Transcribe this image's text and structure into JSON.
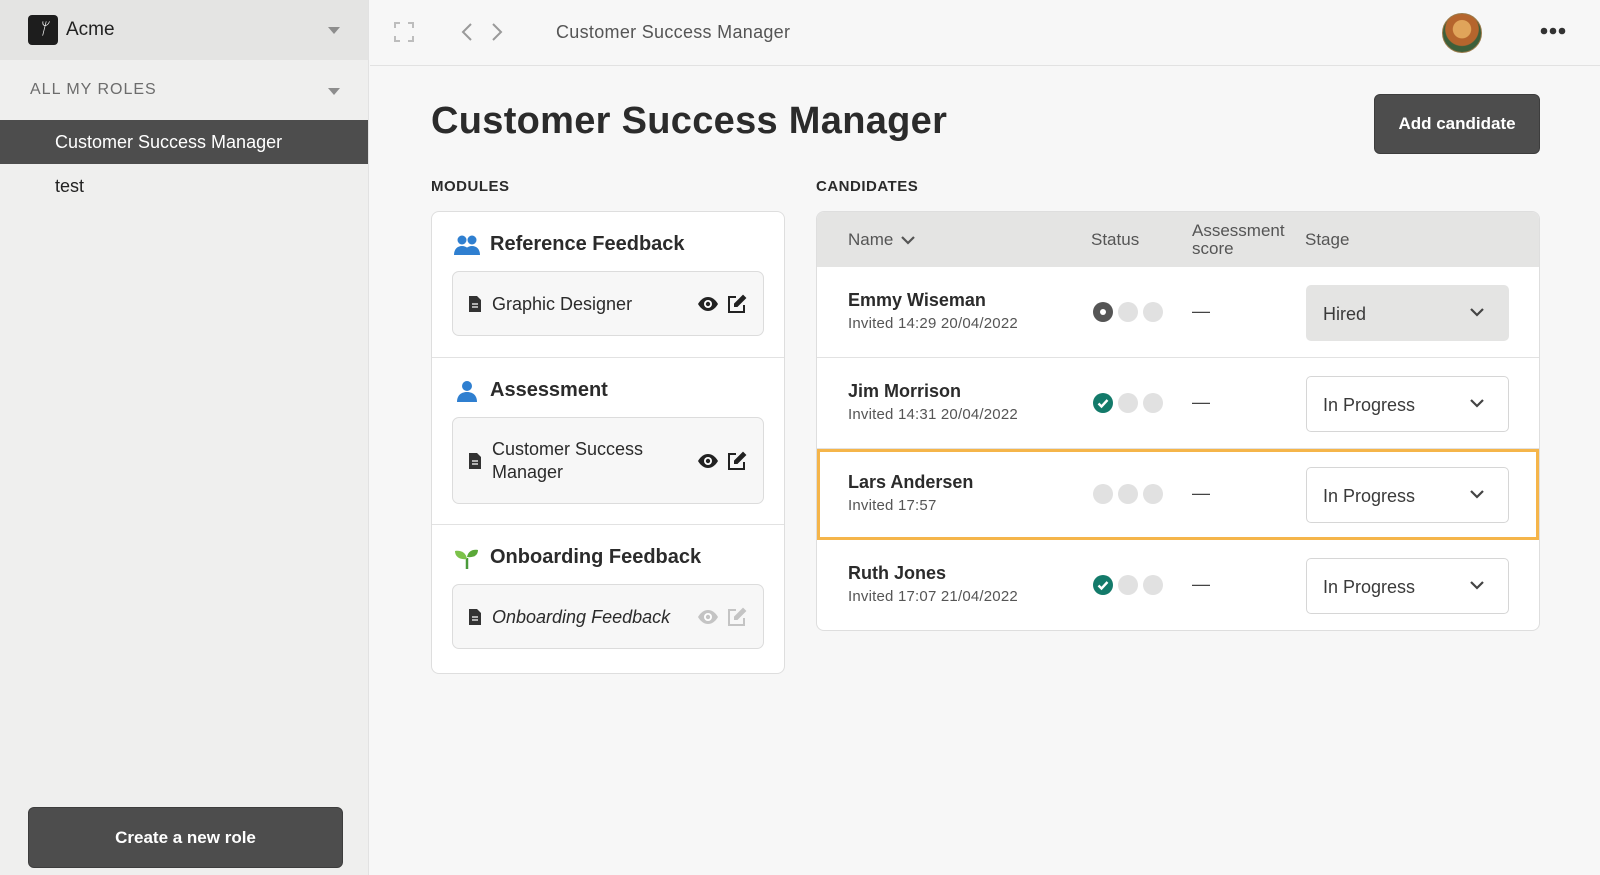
{
  "org": {
    "name": "Acme"
  },
  "sidebar": {
    "roles_title": "ALL MY ROLES",
    "roles": [
      {
        "label": "Customer Success Manager",
        "active": true
      },
      {
        "label": "test",
        "active": false
      }
    ],
    "create_label": "Create a new role"
  },
  "topbar": {
    "breadcrumb": "Customer Success Manager"
  },
  "main": {
    "title": "Customer Success Manager",
    "add_candidate_label": "Add candidate",
    "modules_label": "MODULES",
    "candidates_label": "CANDIDATES"
  },
  "modules": [
    {
      "title": "Reference Feedback",
      "icon": "people-icon",
      "card": "Graphic Designer",
      "italic": false
    },
    {
      "title": "Assessment",
      "icon": "person-icon",
      "card": "Customer Success Manager",
      "italic": false
    },
    {
      "title": "Onboarding Feedback",
      "icon": "seedling-icon",
      "card": "Onboarding Feedback",
      "italic": true
    }
  ],
  "candidates_table": {
    "headers": {
      "name": "Name",
      "status": "Status",
      "score": "Assessment score",
      "stage": "Stage"
    },
    "rows": [
      {
        "name": "Emmy Wiseman",
        "invited": "Invited 14:29 20/04/2022",
        "status": [
          "current",
          "pending",
          "pending"
        ],
        "score": "—",
        "stage": "Hired",
        "highlight": false
      },
      {
        "name": "Jim Morrison",
        "invited": "Invited 14:31 20/04/2022",
        "status": [
          "done",
          "pending",
          "pending"
        ],
        "score": "—",
        "stage": "In Progress",
        "highlight": false
      },
      {
        "name": "Lars Andersen",
        "invited": "Invited 17:57",
        "status": [
          "pending",
          "pending",
          "pending"
        ],
        "score": "—",
        "stage": "In Progress",
        "highlight": true
      },
      {
        "name": "Ruth Jones",
        "invited": "Invited 17:07 21/04/2022",
        "status": [
          "done",
          "pending",
          "pending"
        ],
        "score": "—",
        "stage": "In Progress",
        "highlight": false
      }
    ]
  },
  "colors": {
    "accent_dark": "#4d4d4d",
    "success": "#137a6a",
    "highlight": "#f5b54a"
  }
}
